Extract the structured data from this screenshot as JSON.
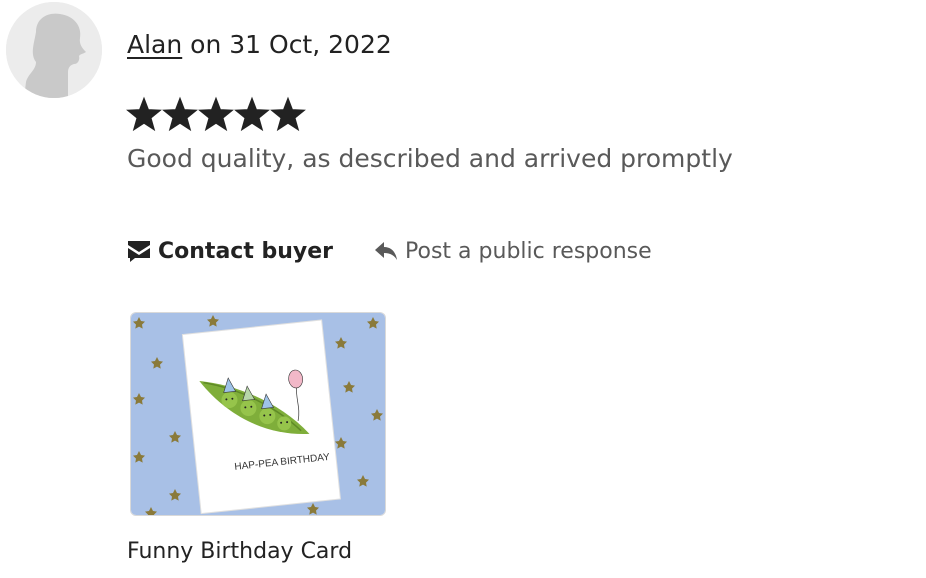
{
  "review": {
    "reviewer_name": "Alan",
    "date_text": " on 31 Oct, 2022",
    "rating": 5,
    "rating_max": 5,
    "text": "Good quality, as described and arrived promptly"
  },
  "actions": {
    "contact_label": "Contact buyer",
    "contact_icon": "envelope-icon",
    "response_label": "Post a public response",
    "response_icon": "reply-arrow-icon"
  },
  "product": {
    "title": "Funny Birthday Card",
    "image_text": "HAP-PEA BIRTHDAY"
  },
  "colors": {
    "text": "#222222",
    "secondary_text": "#595959",
    "star": "#222222",
    "avatar_bg": "#ececec",
    "thumb_bg": "#a8c0e6"
  }
}
